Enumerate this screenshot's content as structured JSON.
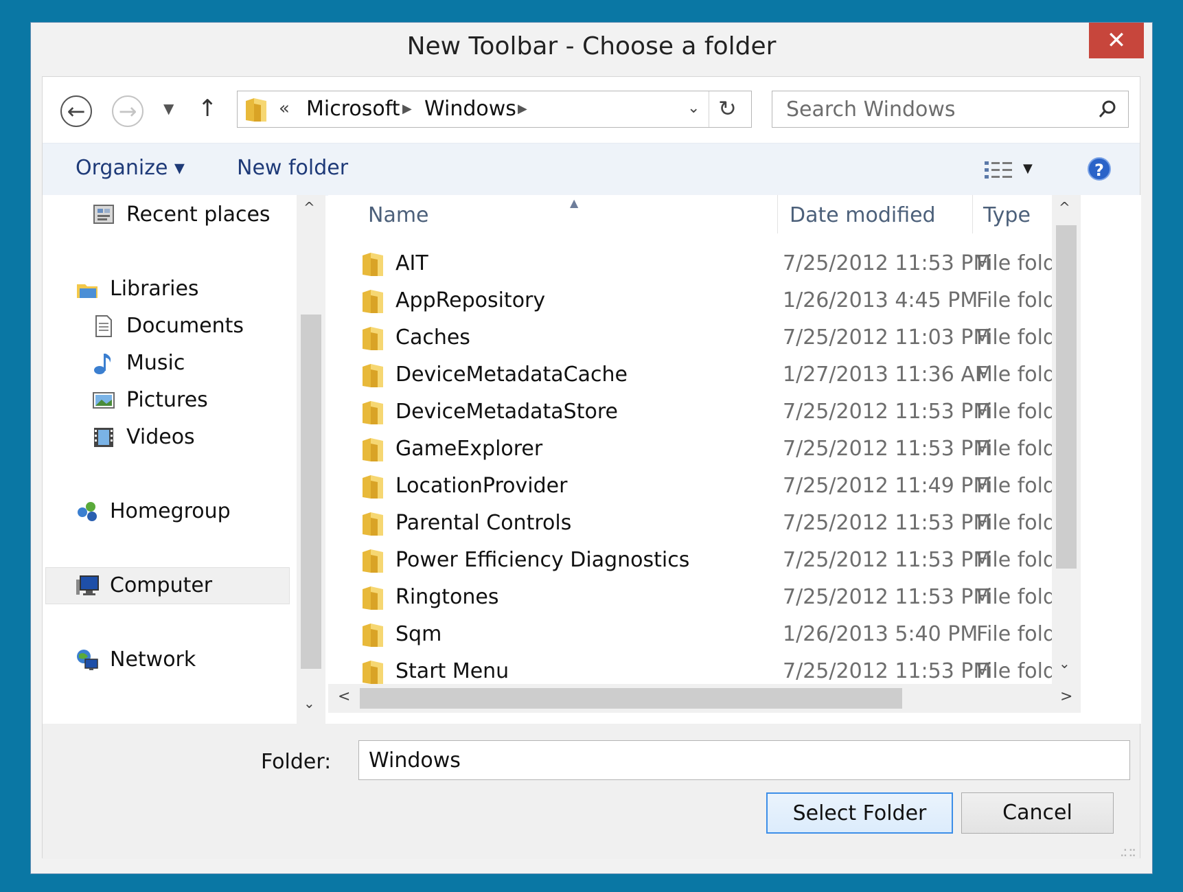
{
  "window": {
    "title": "New Toolbar - Choose a folder",
    "close_glyph": "✕"
  },
  "navigation": {
    "back_glyph": "←",
    "forward_glyph": "→",
    "recent_dropdown_glyph": "▼",
    "up_glyph": "↑",
    "address": {
      "overflow_glyph": "«",
      "crumbs": [
        "Microsoft",
        "Windows"
      ],
      "separator_glyph": "▶",
      "dropdown_glyph": "⌄",
      "refresh_glyph": "↻"
    },
    "search": {
      "placeholder": "Search Windows"
    }
  },
  "command_bar": {
    "organize_label": "Organize ▾",
    "new_folder_label": "New folder",
    "views_dropdown_glyph": "▼",
    "help_glyph": "?"
  },
  "nav_pane": {
    "items": [
      {
        "label": "Recent places",
        "icon": "recent-places-icon"
      },
      {
        "label": "Libraries",
        "icon": "libraries-icon"
      },
      {
        "label": "Documents",
        "icon": "documents-icon"
      },
      {
        "label": "Music",
        "icon": "music-icon"
      },
      {
        "label": "Pictures",
        "icon": "pictures-icon"
      },
      {
        "label": "Videos",
        "icon": "videos-icon"
      },
      {
        "label": "Homegroup",
        "icon": "homegroup-icon"
      },
      {
        "label": "Computer",
        "icon": "computer-icon",
        "selected": true
      },
      {
        "label": "Network",
        "icon": "network-icon"
      }
    ],
    "scroll_up_glyph": "^",
    "scroll_down_glyph": "⌄"
  },
  "file_list": {
    "columns": [
      "Name",
      "Date modified",
      "Type"
    ],
    "sort_glyph": "▲",
    "rows": [
      {
        "name": "AIT",
        "date": "7/25/2012 11:53 PM",
        "type": "File folde"
      },
      {
        "name": "AppRepository",
        "date": "1/26/2013 4:45 PM",
        "type": "File folde"
      },
      {
        "name": "Caches",
        "date": "7/25/2012 11:03 PM",
        "type": "File folde"
      },
      {
        "name": "DeviceMetadataCache",
        "date": "1/27/2013 11:36 AM",
        "type": "File folde"
      },
      {
        "name": "DeviceMetadataStore",
        "date": "7/25/2012 11:53 PM",
        "type": "File folde"
      },
      {
        "name": "GameExplorer",
        "date": "7/25/2012 11:53 PM",
        "type": "File folde"
      },
      {
        "name": "LocationProvider",
        "date": "7/25/2012 11:49 PM",
        "type": "File folde"
      },
      {
        "name": "Parental Controls",
        "date": "7/25/2012 11:53 PM",
        "type": "File folde"
      },
      {
        "name": "Power Efficiency Diagnostics",
        "date": "7/25/2012 11:53 PM",
        "type": "File folde"
      },
      {
        "name": "Ringtones",
        "date": "7/25/2012 11:53 PM",
        "type": "File folde"
      },
      {
        "name": "Sqm",
        "date": "1/26/2013 5:40 PM",
        "type": "File folde"
      },
      {
        "name": "Start Menu",
        "date": "7/25/2012 11:53 PM",
        "type": "File folde"
      }
    ],
    "scroll_up_glyph": "^",
    "scroll_down_glyph": "⌄",
    "scroll_left_glyph": "<",
    "scroll_right_glyph": ">"
  },
  "footer": {
    "folder_label": "Folder:",
    "folder_value": "Windows",
    "select_button": "Select Folder",
    "cancel_button": "Cancel"
  }
}
